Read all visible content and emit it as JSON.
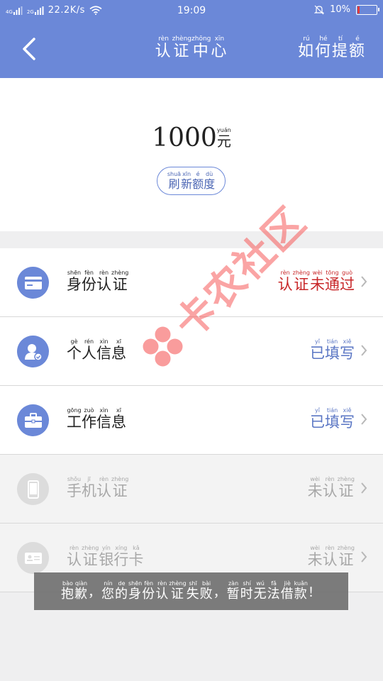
{
  "status_bar": {
    "signal1": "4G",
    "signal2": "2G",
    "speed": "22.2K/s",
    "time": "19:09",
    "battery_text": "10%",
    "battery_level": 0.1
  },
  "header": {
    "title": [
      {
        "char": "认",
        "pinyin": "rèn"
      },
      {
        "char": "证",
        "pinyin": "zhèng"
      },
      {
        "char": "中",
        "pinyin": "zhōng"
      },
      {
        "char": "心",
        "pinyin": "xīn"
      }
    ],
    "help": [
      {
        "char": "如",
        "pinyin": "rú"
      },
      {
        "char": "何",
        "pinyin": "hé"
      },
      {
        "char": "提",
        "pinyin": "tí"
      },
      {
        "char": "额",
        "pinyin": "é"
      }
    ]
  },
  "amount": {
    "value": "1000",
    "unit": {
      "char": "元",
      "pinyin": "yuán"
    },
    "refresh": [
      {
        "char": "刷",
        "pinyin": "shuā"
      },
      {
        "char": "新",
        "pinyin": "xīn"
      },
      {
        "char": "额",
        "pinyin": "é"
      },
      {
        "char": "度",
        "pinyin": "dù"
      }
    ]
  },
  "items": [
    {
      "icon": "id-card-icon",
      "state": "active",
      "label": [
        {
          "char": "身",
          "pinyin": "shēn"
        },
        {
          "char": "份",
          "pinyin": "fèn"
        },
        {
          "char": "认",
          "pinyin": "rèn"
        },
        {
          "char": "证",
          "pinyin": "zhèng"
        }
      ],
      "status": [
        {
          "char": "认",
          "pinyin": "rèn"
        },
        {
          "char": "证",
          "pinyin": "zhèng"
        },
        {
          "char": "未",
          "pinyin": "wèi"
        },
        {
          "char": "通",
          "pinyin": "tōng"
        },
        {
          "char": "过",
          "pinyin": "guò"
        }
      ],
      "status_color": "#c8282a"
    },
    {
      "icon": "user-check-icon",
      "state": "active",
      "label": [
        {
          "char": "个",
          "pinyin": "gè"
        },
        {
          "char": "人",
          "pinyin": "rén"
        },
        {
          "char": "信",
          "pinyin": "xìn"
        },
        {
          "char": "息",
          "pinyin": "xī"
        }
      ],
      "status": [
        {
          "char": "已",
          "pinyin": "yǐ"
        },
        {
          "char": "填",
          "pinyin": "tián"
        },
        {
          "char": "写",
          "pinyin": "xiě"
        }
      ],
      "status_color": "#5a76c4"
    },
    {
      "icon": "briefcase-icon",
      "state": "active",
      "label": [
        {
          "char": "工",
          "pinyin": "gōng"
        },
        {
          "char": "作",
          "pinyin": "zuò"
        },
        {
          "char": "信",
          "pinyin": "xìn"
        },
        {
          "char": "息",
          "pinyin": "xī"
        }
      ],
      "status": [
        {
          "char": "已",
          "pinyin": "yǐ"
        },
        {
          "char": "填",
          "pinyin": "tián"
        },
        {
          "char": "写",
          "pinyin": "xiě"
        }
      ],
      "status_color": "#5a76c4"
    },
    {
      "icon": "phone-icon",
      "state": "disabled",
      "label": [
        {
          "char": "手",
          "pinyin": "shǒu"
        },
        {
          "char": "机",
          "pinyin": "jī"
        },
        {
          "char": "认",
          "pinyin": "rèn"
        },
        {
          "char": "证",
          "pinyin": "zhèng"
        }
      ],
      "status": [
        {
          "char": "未",
          "pinyin": "wèi"
        },
        {
          "char": "认",
          "pinyin": "rèn"
        },
        {
          "char": "证",
          "pinyin": "zhèng"
        }
      ],
      "status_color": "#a8a8a8"
    },
    {
      "icon": "bank-card-icon",
      "state": "disabled",
      "label": [
        {
          "char": "认",
          "pinyin": "rèn"
        },
        {
          "char": "证",
          "pinyin": "zhèng"
        },
        {
          "char": "银",
          "pinyin": "yín"
        },
        {
          "char": "行",
          "pinyin": "xíng"
        },
        {
          "char": "卡",
          "pinyin": "kǎ"
        }
      ],
      "status": [
        {
          "char": "未",
          "pinyin": "wèi"
        },
        {
          "char": "认",
          "pinyin": "rèn"
        },
        {
          "char": "证",
          "pinyin": "zhèng"
        }
      ],
      "status_color": "#a8a8a8"
    }
  ],
  "toast": [
    {
      "char": "抱",
      "pinyin": "bào"
    },
    {
      "char": "歉",
      "pinyin": "qiàn"
    },
    {
      "char": "，",
      "pinyin": ""
    },
    {
      "char": "您",
      "pinyin": "nín"
    },
    {
      "char": "的",
      "pinyin": "de"
    },
    {
      "char": "身",
      "pinyin": "shēn"
    },
    {
      "char": "份",
      "pinyin": "fèn"
    },
    {
      "char": "认",
      "pinyin": "rèn"
    },
    {
      "char": "证",
      "pinyin": "zhèng"
    },
    {
      "char": "失",
      "pinyin": "shī"
    },
    {
      "char": "败",
      "pinyin": "bài"
    },
    {
      "char": "，",
      "pinyin": ""
    },
    {
      "char": "暂",
      "pinyin": "zàn"
    },
    {
      "char": "时",
      "pinyin": "shí"
    },
    {
      "char": "无",
      "pinyin": "wú"
    },
    {
      "char": "法",
      "pinyin": "fǎ"
    },
    {
      "char": "借",
      "pinyin": "jiè"
    },
    {
      "char": "款",
      "pinyin": "kuǎn"
    },
    {
      "char": "！",
      "pinyin": ""
    }
  ],
  "watermark": "卡农社区",
  "colors": {
    "header": "#6b88d8",
    "accent": "#4b66b4",
    "error": "#c8282a"
  }
}
